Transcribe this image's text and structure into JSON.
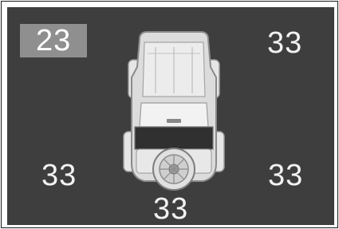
{
  "tire_pressures": {
    "front_left": "23",
    "front_right": "33",
    "rear_left": "33",
    "rear_right": "33",
    "spare": "33"
  },
  "status": {
    "low_pressure_tire": "front_left"
  },
  "colors": {
    "background": "#3e3e3e",
    "alert_highlight": "#8f8f8f",
    "text": "#f2f2f2",
    "vehicle": "#d9d9d9"
  },
  "icons": {
    "vehicle": "vehicle-top-view-icon",
    "spare_tire": "spare-tire-icon"
  }
}
